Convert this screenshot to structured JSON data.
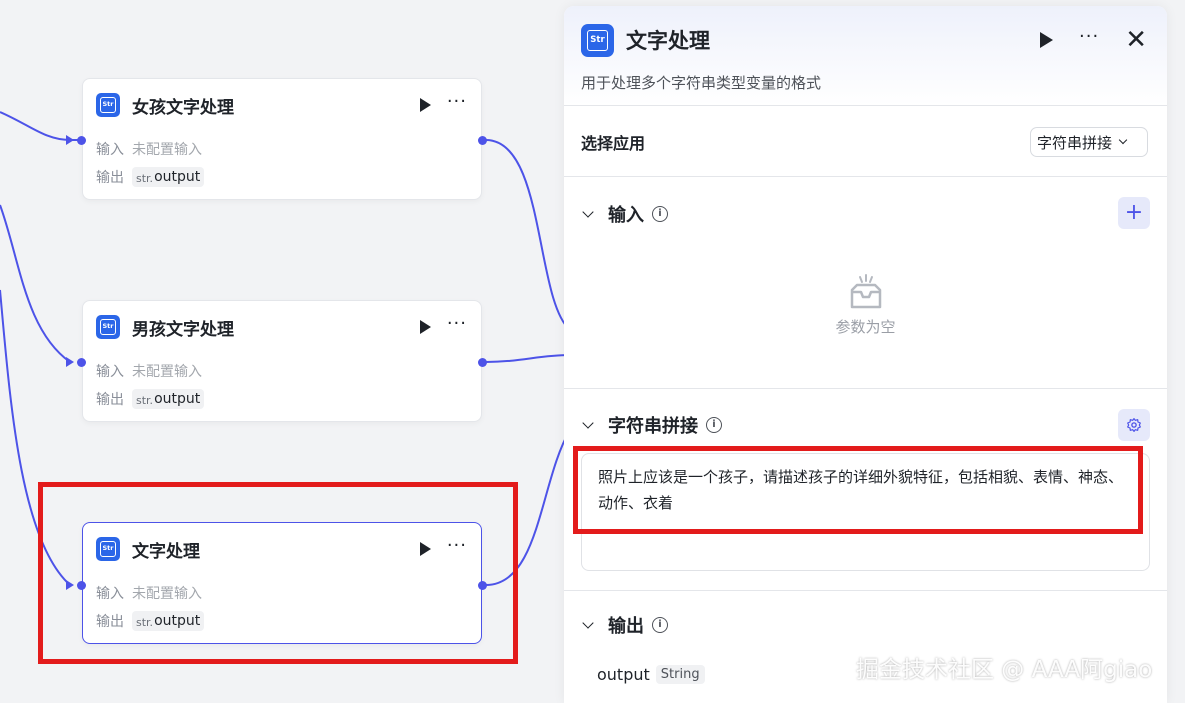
{
  "nodes": [
    {
      "title": "女孩文字处理",
      "input_label": "输入",
      "input_value": "未配置输入",
      "output_label": "输出",
      "output_prefix": "str.",
      "output_value": "output"
    },
    {
      "title": "男孩文字处理",
      "input_label": "输入",
      "input_value": "未配置输入",
      "output_label": "输出",
      "output_prefix": "str.",
      "output_value": "output"
    },
    {
      "title": "文字处理",
      "input_label": "输入",
      "input_value": "未配置输入",
      "output_label": "输出",
      "output_prefix": "str.",
      "output_value": "output"
    }
  ],
  "app_icon_text": "Str",
  "panel": {
    "title": "文字处理",
    "description": "用于处理多个字符串类型变量的格式",
    "select_app_label": "选择应用",
    "select_app_value": "字符串拼接",
    "input_section": {
      "title": "输入",
      "empty_text": "参数为空"
    },
    "concat_section": {
      "title": "字符串拼接",
      "text": "照片上应该是一个孩子，请描述孩子的详细外貌特征，包括相貌、表情、神态、动作、衣着"
    },
    "output_section": {
      "title": "输出",
      "var_name": "output",
      "var_type": "String"
    }
  },
  "watermark": "掘金技术社区 @ AAA阿giao",
  "colors": {
    "accent": "#4d53e8",
    "app_icon": "#2b66e8",
    "highlight": "#e31b1b"
  }
}
